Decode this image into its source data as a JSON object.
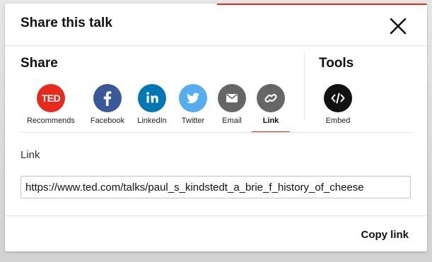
{
  "dialog": {
    "title": "Share this talk",
    "close_icon": "close-icon"
  },
  "share": {
    "heading": "Share",
    "options": [
      {
        "label": "Recommends",
        "icon": "ted-logo-icon",
        "color": "#e62b1e"
      },
      {
        "label": "Facebook",
        "icon": "facebook-icon",
        "color": "#3b5998"
      },
      {
        "label": "LinkedIn",
        "icon": "linkedin-icon",
        "color": "#0077b5"
      },
      {
        "label": "Twitter",
        "icon": "twitter-icon",
        "color": "#55acee"
      },
      {
        "label": "Email",
        "icon": "email-icon",
        "color": "#666666"
      },
      {
        "label": "Link",
        "icon": "link-icon",
        "color": "#666666",
        "active": true
      }
    ],
    "ted_logo_text": "TED"
  },
  "tools": {
    "heading": "Tools",
    "options": [
      {
        "label": "Embed",
        "icon": "code-icon",
        "color": "#111111"
      }
    ]
  },
  "link": {
    "label": "Link",
    "value": "https://www.ted.com/talks/paul_s_kindstedt_a_brie_f_history_of_cheese"
  },
  "footer": {
    "copy_label": "Copy link"
  },
  "colors": {
    "accent": "#e62b1e"
  }
}
